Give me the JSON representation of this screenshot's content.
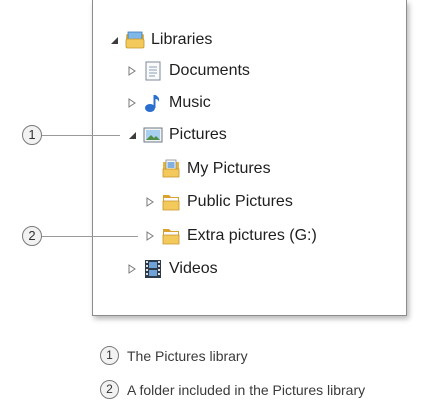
{
  "tree": {
    "libraries": {
      "label": "Libraries",
      "icon": "libraries-icon",
      "expanded": true
    },
    "documents": {
      "label": "Documents",
      "icon": "documents-library-icon"
    },
    "music": {
      "label": "Music",
      "icon": "music-note-icon"
    },
    "pictures": {
      "label": "Pictures",
      "icon": "pictures-library-icon",
      "expanded": true
    },
    "my_pictures": {
      "label": "My Pictures",
      "icon": "my-pictures-folder-icon"
    },
    "public_pictures": {
      "label": "Public Pictures",
      "icon": "folder-icon"
    },
    "extra_pictures": {
      "label": "Extra pictures (G:)",
      "icon": "folder-icon"
    },
    "videos": {
      "label": "Videos",
      "icon": "film-icon"
    }
  },
  "callouts": [
    {
      "number": "1"
    },
    {
      "number": "2"
    }
  ],
  "legend": [
    {
      "number": "1",
      "text": "The Pictures library"
    },
    {
      "number": "2",
      "text": "A folder included in the Pictures library"
    }
  ],
  "colors": {
    "folder_yellow": "#e8b53a",
    "music_blue": "#2a6fd0",
    "panel_border": "#8c8c8c",
    "leader_line": "#9a9a9a"
  }
}
